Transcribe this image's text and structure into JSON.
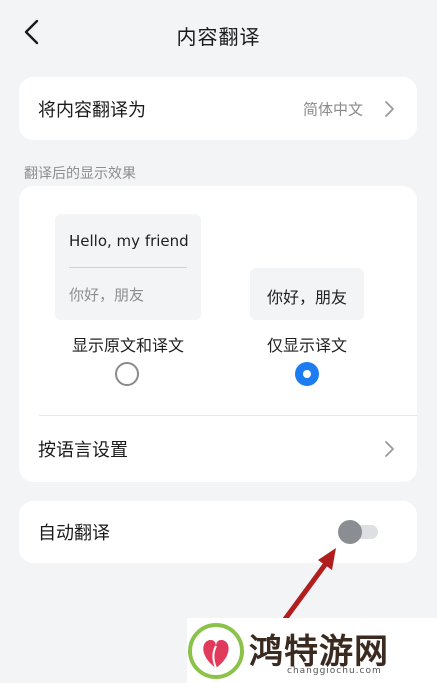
{
  "header": {
    "title": "内容翻译",
    "back_icon": "chevron-left-icon"
  },
  "translate_target": {
    "label": "将内容翻译为",
    "value": "简体中文"
  },
  "display_section": {
    "title": "翻译后的显示效果",
    "option_both": {
      "preview_original": "Hello, my friend",
      "preview_translation": "你好，朋友",
      "label": "显示原文和译文",
      "selected": false
    },
    "option_translation_only": {
      "preview_translation": "你好，朋友",
      "label": "仅显示译文",
      "selected": true
    },
    "language_settings_label": "按语言设置"
  },
  "auto_translate": {
    "label": "自动翻译",
    "enabled": false
  },
  "watermark": {
    "text": "鸿特游网",
    "subtext": "changgiochu.com"
  },
  "colors": {
    "accent": "#1e7cf2",
    "background": "#f3f4f6",
    "card": "#ffffff",
    "annotation_arrow": "#b01e1e"
  }
}
